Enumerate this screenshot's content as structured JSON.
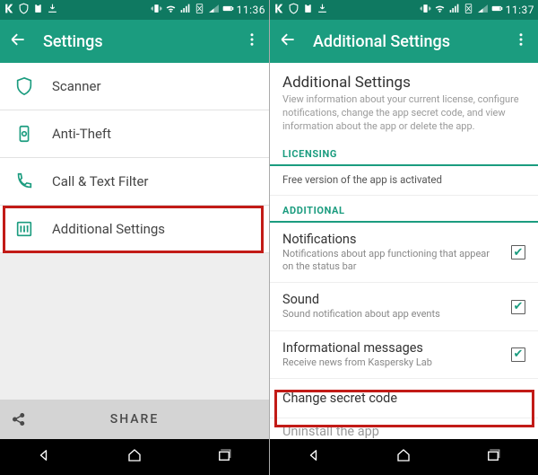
{
  "status": {
    "time_left": "11:36",
    "time_right": "11:37"
  },
  "left": {
    "title": "Settings",
    "items": [
      {
        "label": "Scanner"
      },
      {
        "label": "Anti-Theft"
      },
      {
        "label": "Call & Text Filter"
      },
      {
        "label": "Additional Settings"
      }
    ],
    "share": "SHARE"
  },
  "right": {
    "title": "Additional Settings",
    "heading": "Additional Settings",
    "desc": "View information about your current license, configure notifications, change the app secret code, and view information about the app or delete the app.",
    "licensing_header": "LICENSING",
    "licensing_text": "Free version of the app is activated",
    "additional_header": "ADDITIONAL",
    "rows": [
      {
        "title": "Notifications",
        "sub": "Notifications about app functioning that appear on the status bar",
        "checked": true
      },
      {
        "title": "Sound",
        "sub": "Sound notification about app events",
        "checked": true
      },
      {
        "title": "Informational messages",
        "sub": "Receive news from Kaspersky Lab",
        "checked": true
      },
      {
        "title": "Change secret code",
        "sub": "",
        "checked": null
      },
      {
        "title": "Uninstall the app",
        "sub": "",
        "checked": null
      }
    ]
  }
}
